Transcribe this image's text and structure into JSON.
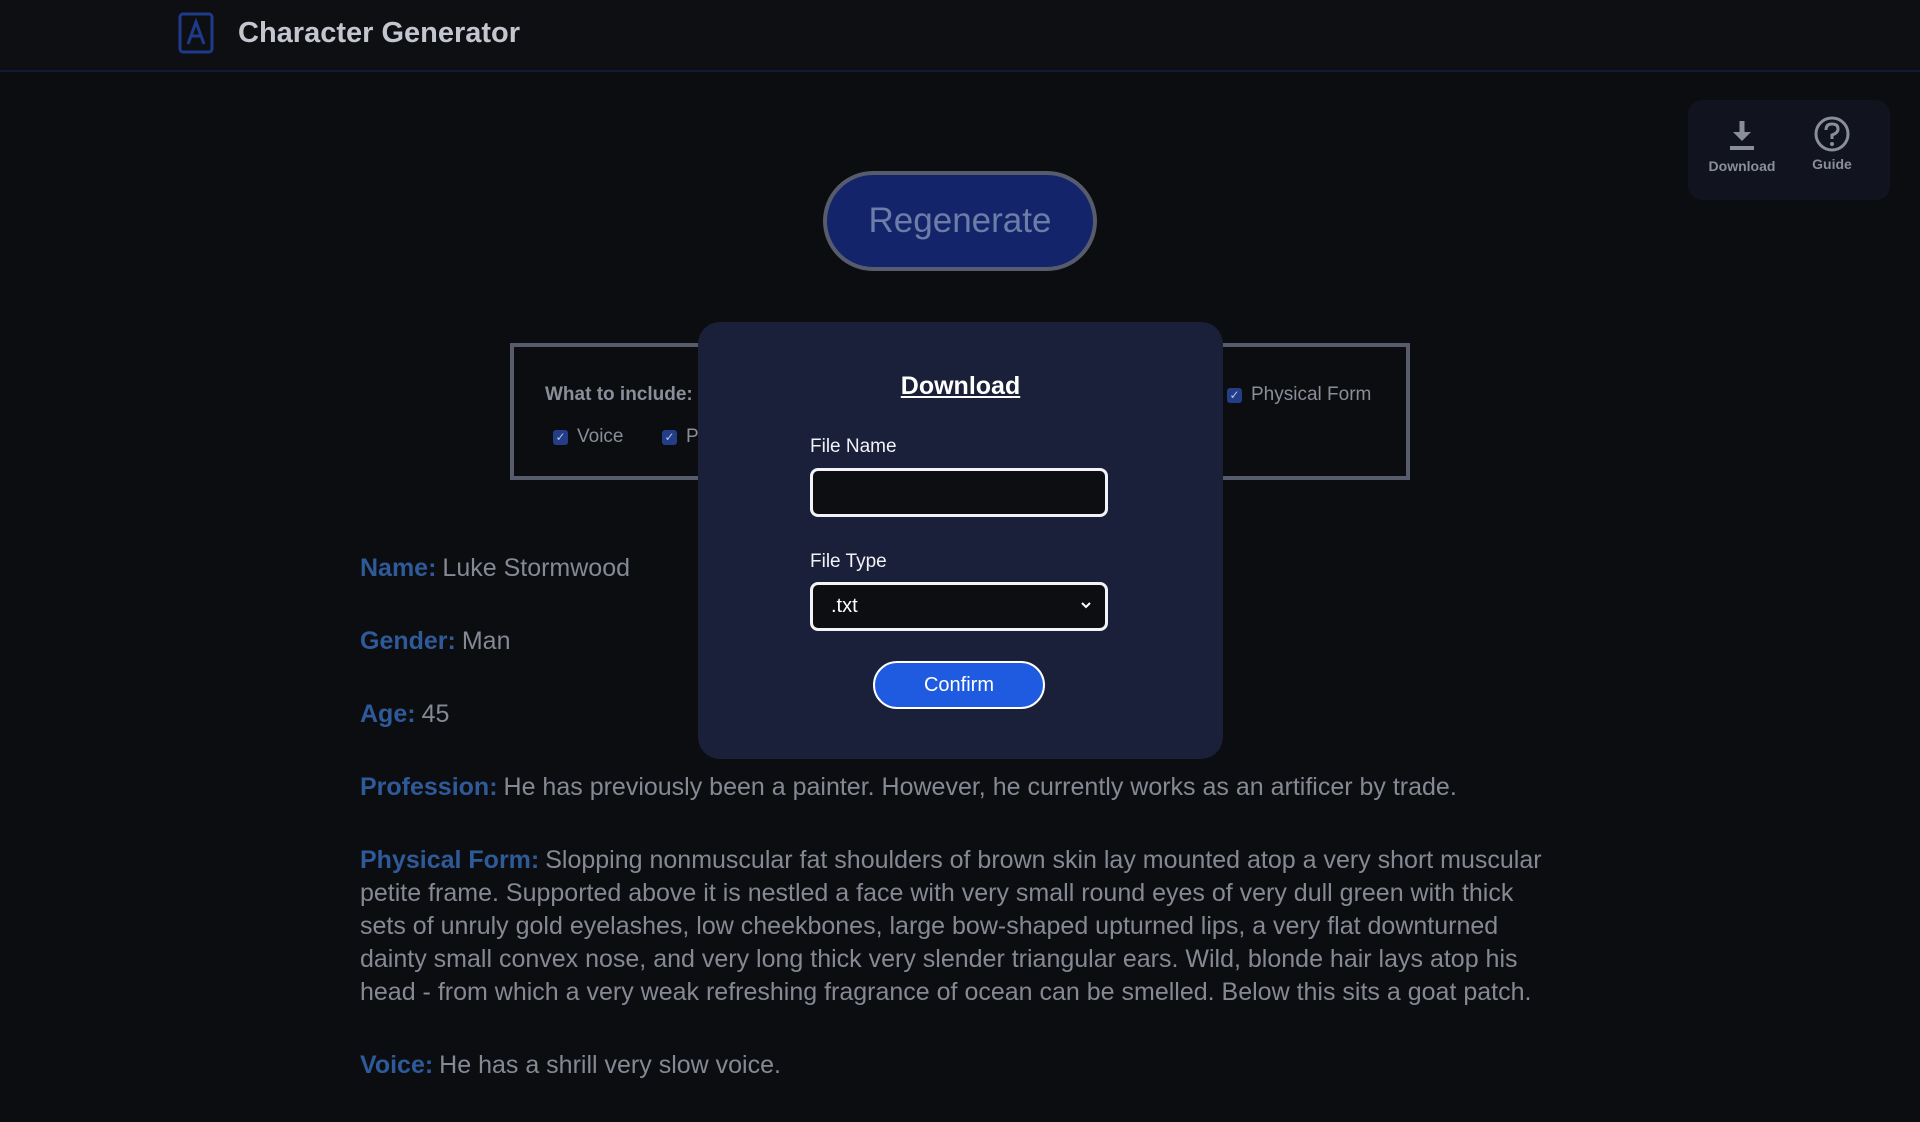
{
  "header": {
    "title": "Character Generator"
  },
  "actions": {
    "regenerate_label": "Regenerate"
  },
  "toolbar": {
    "download_label": "Download",
    "guide_label": "Guide"
  },
  "options": {
    "heading": "What to include:",
    "items": [
      {
        "label": "Voice",
        "checked": true
      },
      {
        "label": "P",
        "checked": true
      },
      {
        "label": "Physical Form",
        "checked": true
      }
    ]
  },
  "character": {
    "name": {
      "label": "Name:",
      "value": "Luke Stormwood"
    },
    "gender": {
      "label": "Gender:",
      "value": "Man"
    },
    "age": {
      "label": "Age:",
      "value": "45"
    },
    "profession": {
      "label": "Profession:",
      "value": "He has previously been a painter. However, he currently works as an artificer by trade."
    },
    "physical_form": {
      "label": "Physical Form:",
      "value": "Slopping nonmuscular fat shoulders of brown skin lay mounted atop a very short muscular petite frame. Supported above it is nestled a face with very small round eyes of very dull green with thick sets of unruly gold eyelashes, low cheekbones, large bow-shaped upturned lips, a very flat downturned dainty small convex nose, and very long thick very slender triangular ears. Wild, blonde hair lays atop his head - from which a very weak refreshing fragrance of ocean can be smelled. Below this sits a goat patch."
    },
    "voice": {
      "label": "Voice:",
      "value": "He has a shrill very slow voice."
    }
  },
  "modal": {
    "title": "Download",
    "file_name_label": "File Name",
    "file_name_value": "",
    "file_type_label": "File Type",
    "file_type_value": ".txt",
    "confirm_label": "Confirm"
  },
  "colors": {
    "accent": "#1f5be0",
    "modal_bg": "#1a1f3a",
    "label_blue": "#2f5a9a"
  },
  "icons": {
    "logo": "character-logo-icon",
    "download": "download-icon",
    "guide": "question-circle-icon",
    "checkbox": "checkmark-icon",
    "select": "chevron-down-icon"
  }
}
